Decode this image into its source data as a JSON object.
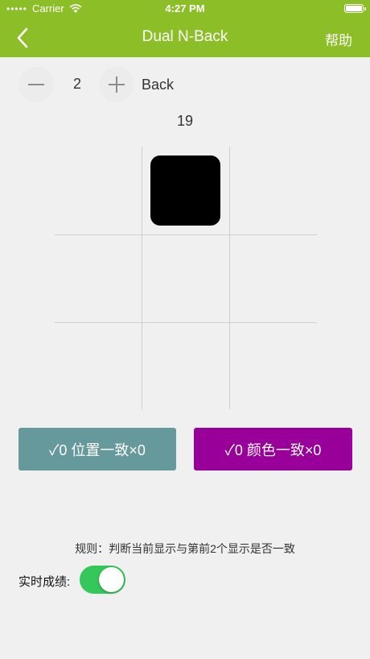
{
  "status_bar": {
    "signal_dots": "•••••",
    "carrier": "Carrier",
    "wifi_icon": "wifi-icon",
    "time": "4:27 PM",
    "battery_icon": "battery-icon"
  },
  "nav": {
    "title": "Dual N-Back",
    "back_icon": "chevron-left-icon",
    "help_label": "帮助"
  },
  "level": {
    "decrement_icon": "minus-icon",
    "value": "2",
    "increment_icon": "plus-icon",
    "unit_label": "Back"
  },
  "round_counter": "19",
  "board": {
    "rows": 3,
    "cols": 3,
    "active_cell": {
      "row": 0,
      "col": 1
    },
    "active_color": "#000000"
  },
  "buttons": {
    "position_match": "✓0 位置一致×0",
    "color_match": "✓0 颜色一致×0"
  },
  "rule_text": "规则：判断当前显示与第前2个显示是否一致",
  "realtime_score": {
    "label": "实时成绩:",
    "enabled": true
  },
  "colors": {
    "nav_bar": "#8cbf27",
    "position_button": "#66999c",
    "color_button": "#990099",
    "toggle_on": "#34c759"
  }
}
